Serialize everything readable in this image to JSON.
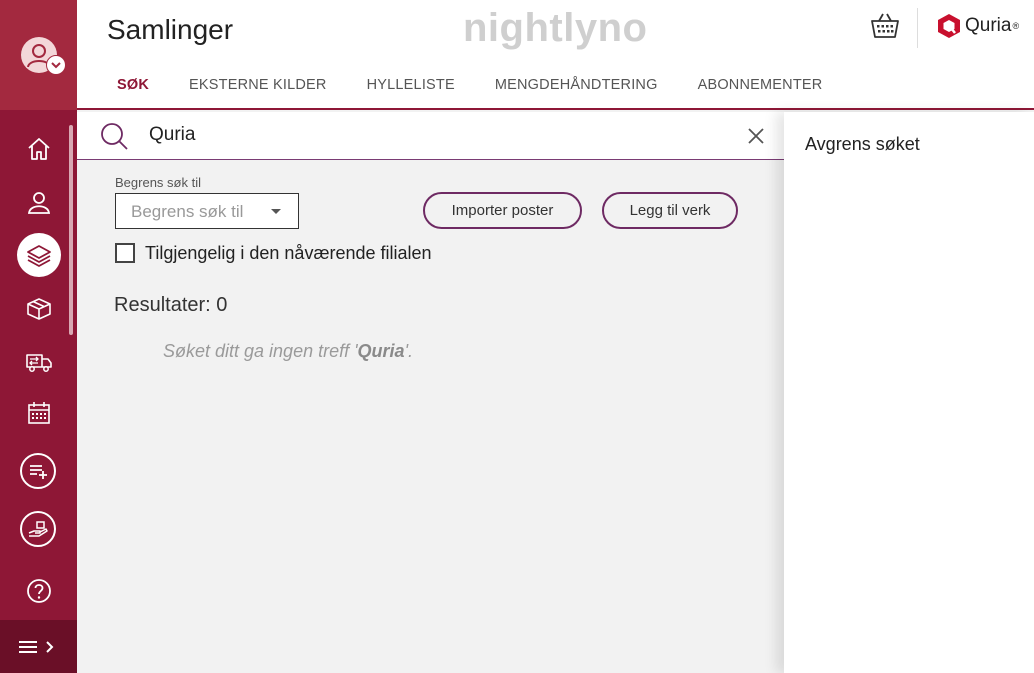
{
  "header": {
    "page_title": "Samlinger",
    "environment": "nightlyno",
    "brand_name": "Quria",
    "brand_mark": "®"
  },
  "tabs": [
    {
      "label": "SØK",
      "active": true
    },
    {
      "label": "EKSTERNE KILDER",
      "active": false
    },
    {
      "label": "HYLLELISTE",
      "active": false
    },
    {
      "label": "MENGDEHÅNDTERING",
      "active": false
    },
    {
      "label": "ABONNEMENTER",
      "active": false
    }
  ],
  "sidebar": {
    "items": [
      {
        "icon": "home-icon"
      },
      {
        "icon": "user-icon"
      },
      {
        "icon": "layers-icon",
        "active": true
      },
      {
        "icon": "box-icon"
      },
      {
        "icon": "delivery-truck-icon"
      },
      {
        "icon": "calendar-icon"
      },
      {
        "icon": "add-list-icon"
      },
      {
        "icon": "hand-package-icon"
      },
      {
        "icon": "help-icon"
      }
    ]
  },
  "search": {
    "value": "Quria",
    "filter_label": "Begrens søk til",
    "filter_placeholder": "Begrens søk til",
    "import_button": "Importer poster",
    "add_work_button": "Legg til verk",
    "checkbox_label": "Tilgjengelig i den nåværende filialen",
    "results_label": "Resultater: 0",
    "no_results_prefix": "Søket ditt ga ingen treff '",
    "no_results_term": "Quria",
    "no_results_suffix": "'."
  },
  "right_panel": {
    "title": "Avgrens søket"
  },
  "colors": {
    "sidebar": "#8e1736",
    "sidebar_top": "#a3293f",
    "accent": "#8e1736",
    "button_border": "#6e2a63"
  }
}
